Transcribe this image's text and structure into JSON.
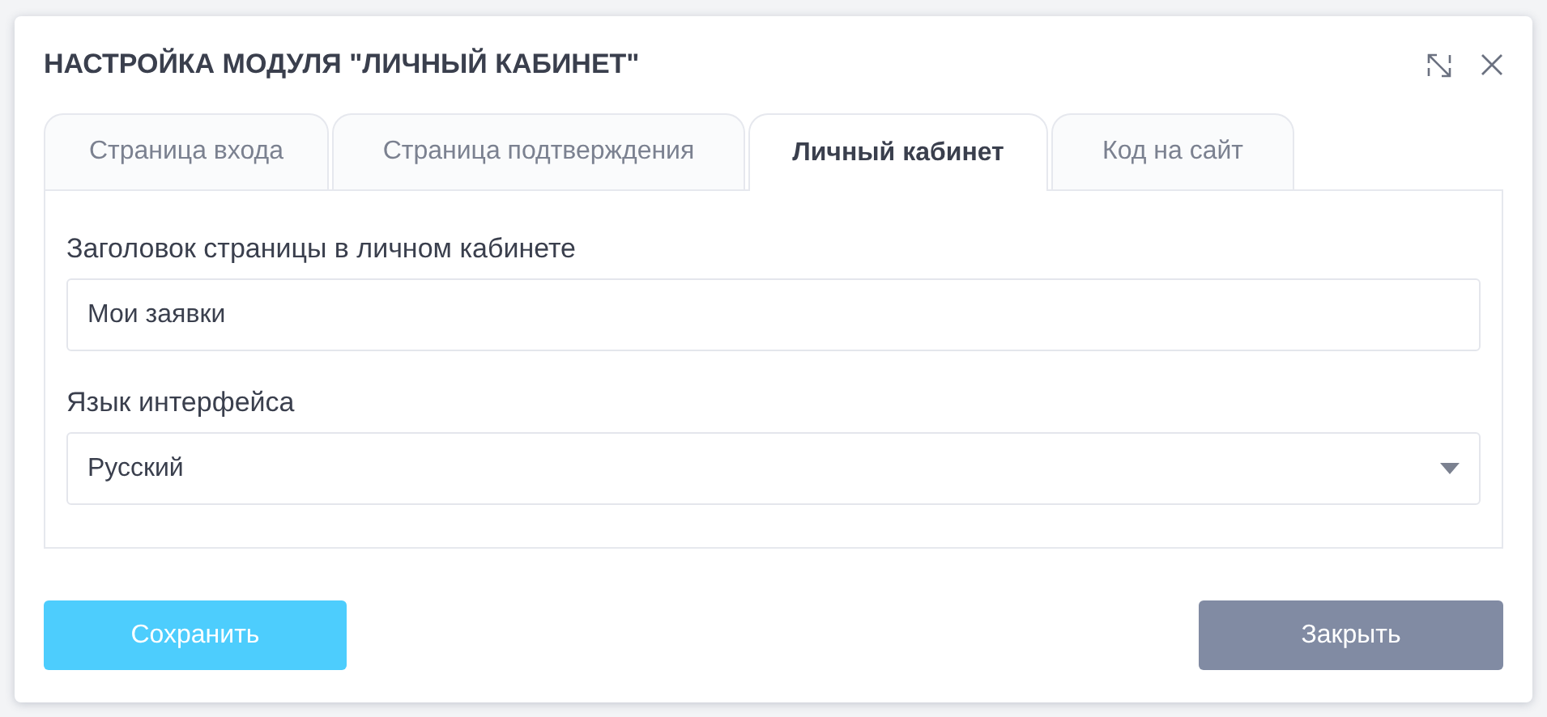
{
  "dialog": {
    "title": "НАСТРОЙКА МОДУЛЯ \"ЛИЧНЫЙ КАБИНЕТ\""
  },
  "tabs": [
    {
      "label": "Страница входа",
      "selected": false
    },
    {
      "label": "Страница подтверждения",
      "selected": false
    },
    {
      "label": "Личный кабинет",
      "selected": true
    },
    {
      "label": "Код на сайт",
      "selected": false
    }
  ],
  "fields": [
    {
      "kind": "text",
      "label": "Заголовок страницы в личном кабинете",
      "value": "Мои заявки"
    },
    {
      "kind": "select",
      "label": "Язык интерфейса",
      "value": "Русский"
    }
  ],
  "buttons": [
    {
      "kind": "primary",
      "label": "Сохранить"
    },
    {
      "kind": "secondary",
      "label": "Закрыть"
    }
  ]
}
